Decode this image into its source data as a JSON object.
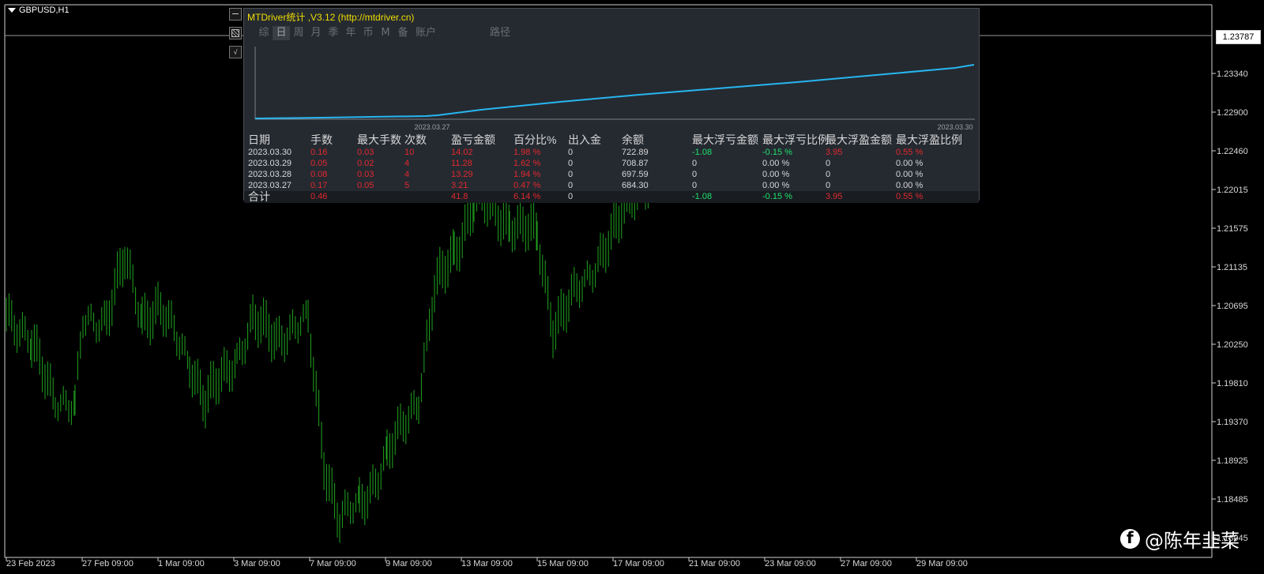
{
  "symbol": "GBPUSD,H1",
  "current_price": "1.23787",
  "price_axis": [
    "1.23340",
    "1.22900",
    "1.22460",
    "1.22015",
    "1.21575",
    "1.21135",
    "1.20695",
    "1.20250",
    "1.19810",
    "1.19370",
    "1.18925",
    "1.18485",
    "1.18045"
  ],
  "time_axis": [
    "23 Feb 2023",
    "27 Feb 09:00",
    "1 Mar 09:00",
    "3 Mar 09:00",
    "7 Mar 09:00",
    "9 Mar 09:00",
    "13 Mar 09:00",
    "15 Mar 09:00",
    "17 Mar 09:00",
    "21 Mar 09:00",
    "23 Mar 09:00",
    "27 Mar 09:00",
    "29 Mar 09:00"
  ],
  "colors": {
    "candle": "#1fa51f",
    "equity_line": "#27b6f0",
    "title": "#f0de00",
    "loss": "#e2282d",
    "profit": "#1fe06b"
  },
  "side_buttons": [
    {
      "icon": "collapse-icon"
    },
    {
      "icon": "image-icon"
    },
    {
      "icon": "checkmark-icon",
      "text": "√"
    }
  ],
  "panel": {
    "title": "MTDriver统计 ,V3.12 (http://mtdriver.cn)",
    "tabs": [
      "综",
      "日",
      "周",
      "月",
      "季",
      "年",
      "币",
      "M",
      "备",
      "账户",
      "路径"
    ],
    "active_tab_index": 1,
    "graph": {
      "start_label": "2023.03.27",
      "end_label": "2023.03.30"
    },
    "table": {
      "headers": [
        "日期",
        "手数",
        "最大手数",
        "次数",
        "盈亏金额",
        "百分比%",
        "出入金",
        "余额",
        "最大浮亏金额",
        "最大浮亏比例",
        "最大浮盈金额",
        "最大浮盈比例"
      ],
      "rows": [
        [
          "2023.03.30",
          "0.16",
          "0.03",
          "10",
          "14.02",
          "1.98 %",
          "0",
          "722.89",
          "-1.08",
          "-0.15 %",
          "3.95",
          "0.55 %"
        ],
        [
          "2023.03.29",
          "0.05",
          "0.02",
          "4",
          "11.28",
          "1.62 %",
          "0",
          "708.87",
          "0",
          "0.00 %",
          "0",
          "0.00 %"
        ],
        [
          "2023.03.28",
          "0.08",
          "0.03",
          "4",
          "13.29",
          "1.94 %",
          "0",
          "697.59",
          "0",
          "0.00 %",
          "0",
          "0.00 %"
        ],
        [
          "2023.03.27",
          "0.17",
          "0.05",
          "5",
          "3.21",
          "0.47 %",
          "0",
          "684.30",
          "0",
          "0.00 %",
          "0",
          "0.00 %"
        ]
      ],
      "total": [
        "合计",
        "0.46",
        "",
        "",
        "41.8",
        "6.14 %",
        "0",
        "",
        "-1.08",
        "-0.15 %",
        "3.95",
        "0.55 %"
      ]
    }
  },
  "watermark": "@陈年韭菜"
}
